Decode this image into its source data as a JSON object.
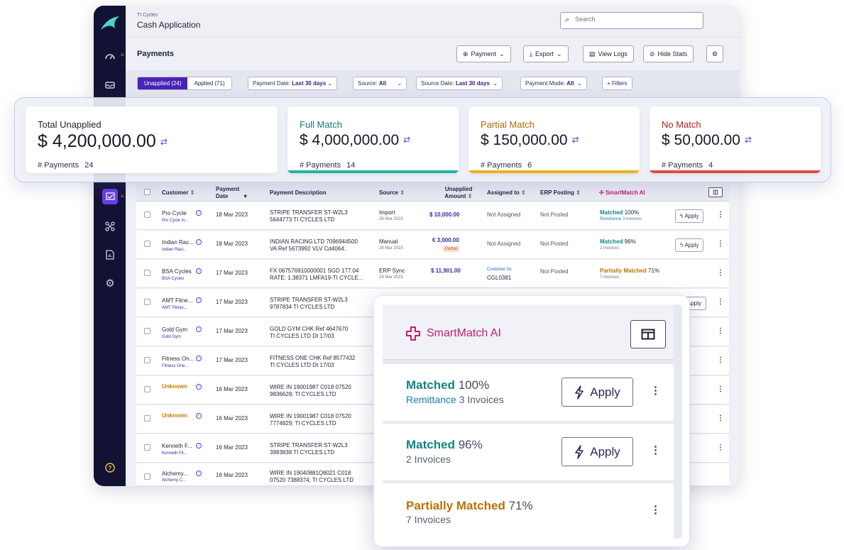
{
  "app": {
    "org": "TI Cycles",
    "title": "Cash Application",
    "search_placeholder": "Search"
  },
  "page": {
    "title": "Payments",
    "buttons": {
      "payment": "Payment",
      "export": "Export",
      "view_logs": "View Logs",
      "hide_stats": "Hide Stats"
    }
  },
  "filters": {
    "unapplied": "Unapplied (24)",
    "applied": "Applied (71)",
    "payment_date_label": "Payment Date:",
    "payment_date_value": "Last 30 days",
    "source_label": "Source:",
    "source_value": "All",
    "source_date_label": "Source Date:",
    "source_date_value": "Last 30 days",
    "payment_mode_label": "Payment Mode:",
    "payment_mode_value": "All",
    "more_filters": "Filters"
  },
  "stats": {
    "total": {
      "title": "Total Unapplied",
      "value": "$ 4,200,000.00",
      "payments_label": "# Payments",
      "payments": "24"
    },
    "full": {
      "title": "Full Match",
      "value": "$ 4,000,000.00",
      "payments_label": "# Payments",
      "payments": "14",
      "color": "#1fb5a2"
    },
    "partial": {
      "title": "Partial Match",
      "value": "$ 150,000.00",
      "payments_label": "# Payments",
      "payments": "6",
      "color": "#eab319"
    },
    "none": {
      "title": "No Match",
      "value": "$ 50,000.00",
      "payments_label": "# Payments",
      "payments": "4",
      "color": "#e24a43"
    }
  },
  "table": {
    "headers": {
      "customer": "Customer",
      "payment_date_1": "Payment",
      "payment_date_2": "Date",
      "description": "Payment Description",
      "source": "Source",
      "amount_1": "Unapplied",
      "amount_2": "Amount",
      "assigned": "Assigned to",
      "erp": "ERP Posting",
      "smartmatch": "SmartMatch AI"
    },
    "rows": [
      {
        "customer": "Pro Cycle",
        "customer_sub": "Pro Cycle In...",
        "date": "18 Mar 2023",
        "desc1": "STRIPE TRANSFER ST-W2L3",
        "desc2": "5644773 TI CYCLES LTD",
        "source": "Import",
        "source_date": "28 Mar 2023",
        "amount": "$ 10,000.00",
        "assigned": "Not Assigned",
        "erp": "Not Posted",
        "match": "Matched",
        "match_pct": "100%",
        "match_sub1": "Remittance",
        "match_sub2": "3 Invoices",
        "apply": "Apply"
      },
      {
        "customer": "Indian Rac...",
        "customer_sub": "Indian Raci...",
        "date": "18 Mar 2023",
        "desc1": "INDIAN RACING LTD 7096944500",
        "desc2": "VA Ref 5673992 VLV Cd4064..",
        "source": "Manual",
        "source_date": "28 Mar 2023",
        "amount": "€ 3,000.00",
        "amount_tag": "Partial",
        "assigned": "Not Assigned",
        "erp": "Not Posted",
        "match": "Matched",
        "match_pct": "96%",
        "match_sub2": "2 Invoices",
        "apply": "Apply"
      },
      {
        "customer": "BSA Cycles",
        "customer_sub": "BSA Cycles",
        "date": "17 Mar 2023",
        "desc1": "FX 067576910000001 SGD 177.04",
        "desc2": "RATE: 1.38371 LMFA19-TI CYCLE...",
        "source": "ERP Sync",
        "source_date": "28 Mar 2023",
        "amount": "$ 11,901.00",
        "assigned": "Customer GL",
        "assigned_sub": "CGL0381",
        "erp": "Not Posted",
        "match": "Partially Matched",
        "match_pct": "71%",
        "match_sub2": "7 Invoices"
      },
      {
        "customer": "AMT Fitne...",
        "customer_sub": "AMT Fitnes...",
        "date": "17 Mar 2023",
        "desc1": "STRIPE TRANSFER ST-W2L3",
        "desc2": "9787834 TI CYCLES LTD",
        "apply": "Apply"
      },
      {
        "customer": "Gold Gym",
        "customer_sub": "Gold Gym",
        "date": "17 Mar 2023",
        "desc1": "GOLD GYM CHK Ref 4647670",
        "desc2": "TI CYCLES LTD Dt 17/03"
      },
      {
        "customer": "Fitness On...",
        "customer_sub": "Fitness One...",
        "date": "17 Mar 2023",
        "desc1": "FITNESS ONE CHK Ref 8577432",
        "desc2": "TI CYCLES LTD Dt 17/03"
      },
      {
        "customer": "Unknown",
        "date": "16 Mar 2023",
        "desc1": "WIRE IN 19001987 C018 07520",
        "desc2": "9836628; TI CYCLES LTD"
      },
      {
        "customer": "Unknown",
        "date": "16 Mar 2023",
        "desc1": "WIRE IN 19001987 C018 07520",
        "desc2": "7774829; TI CYCLES LTD"
      },
      {
        "customer": "Kenneth F...",
        "customer_sub": "Kenneth Fit...",
        "date": "16 Mar 2023",
        "desc1": "STRIPE TRANSFER ST-W2L3",
        "desc2": "3983838 TI CYCLES LTD"
      },
      {
        "customer": "Alchemy...",
        "customer_sub": "Alchemy C...",
        "date": "16 Mar 2023",
        "desc1": "WIRE IN 19040881Q8021 C018",
        "desc2": "07520 7388374; TI CYCLES LTD"
      }
    ]
  },
  "smartmatch_panel": {
    "title": "SmartMatch AI",
    "rows": [
      {
        "status": "Matched",
        "pct": "100%",
        "sub_link": "Remittance",
        "sub": "3 Invoices",
        "apply": "Apply",
        "color": "#11857e"
      },
      {
        "status": "Matched",
        "pct": "96%",
        "sub": "2 Invoices",
        "apply": "Apply",
        "color": "#11857e"
      },
      {
        "status": "Partially Matched",
        "pct": "71%",
        "sub": "7 Invoices",
        "color": "#b67400"
      }
    ]
  }
}
